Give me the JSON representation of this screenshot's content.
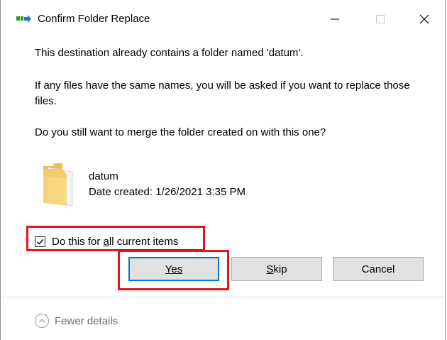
{
  "window": {
    "title": "Confirm Folder Replace",
    "controls": [
      "minimize-icon",
      "maximize-icon",
      "close-icon"
    ]
  },
  "message": {
    "line1": "This destination already contains a folder named 'datum'.",
    "line2": "If any files have the same names, you will be asked if you want to replace those files.",
    "line3": "Do you still want to merge the folder created on  with this one?"
  },
  "folder": {
    "name": "datum",
    "date_created": "Date created: 1/26/2021 3:35 PM",
    "icon": "folder-icon"
  },
  "checkbox": {
    "label_before": "Do this for ",
    "label_mnemonic": "a",
    "label_after": "ll current items",
    "checked": true
  },
  "buttons": {
    "yes": "Yes",
    "skip_mnemonic": "S",
    "skip_rest": "kip",
    "cancel": "Cancel"
  },
  "footer": {
    "details_label": "Fewer details",
    "icon": "chevron-up-icon"
  },
  "colors": {
    "highlight": "#e8141c",
    "accent": "#0078d7",
    "button_bg": "#e1e1e1"
  }
}
